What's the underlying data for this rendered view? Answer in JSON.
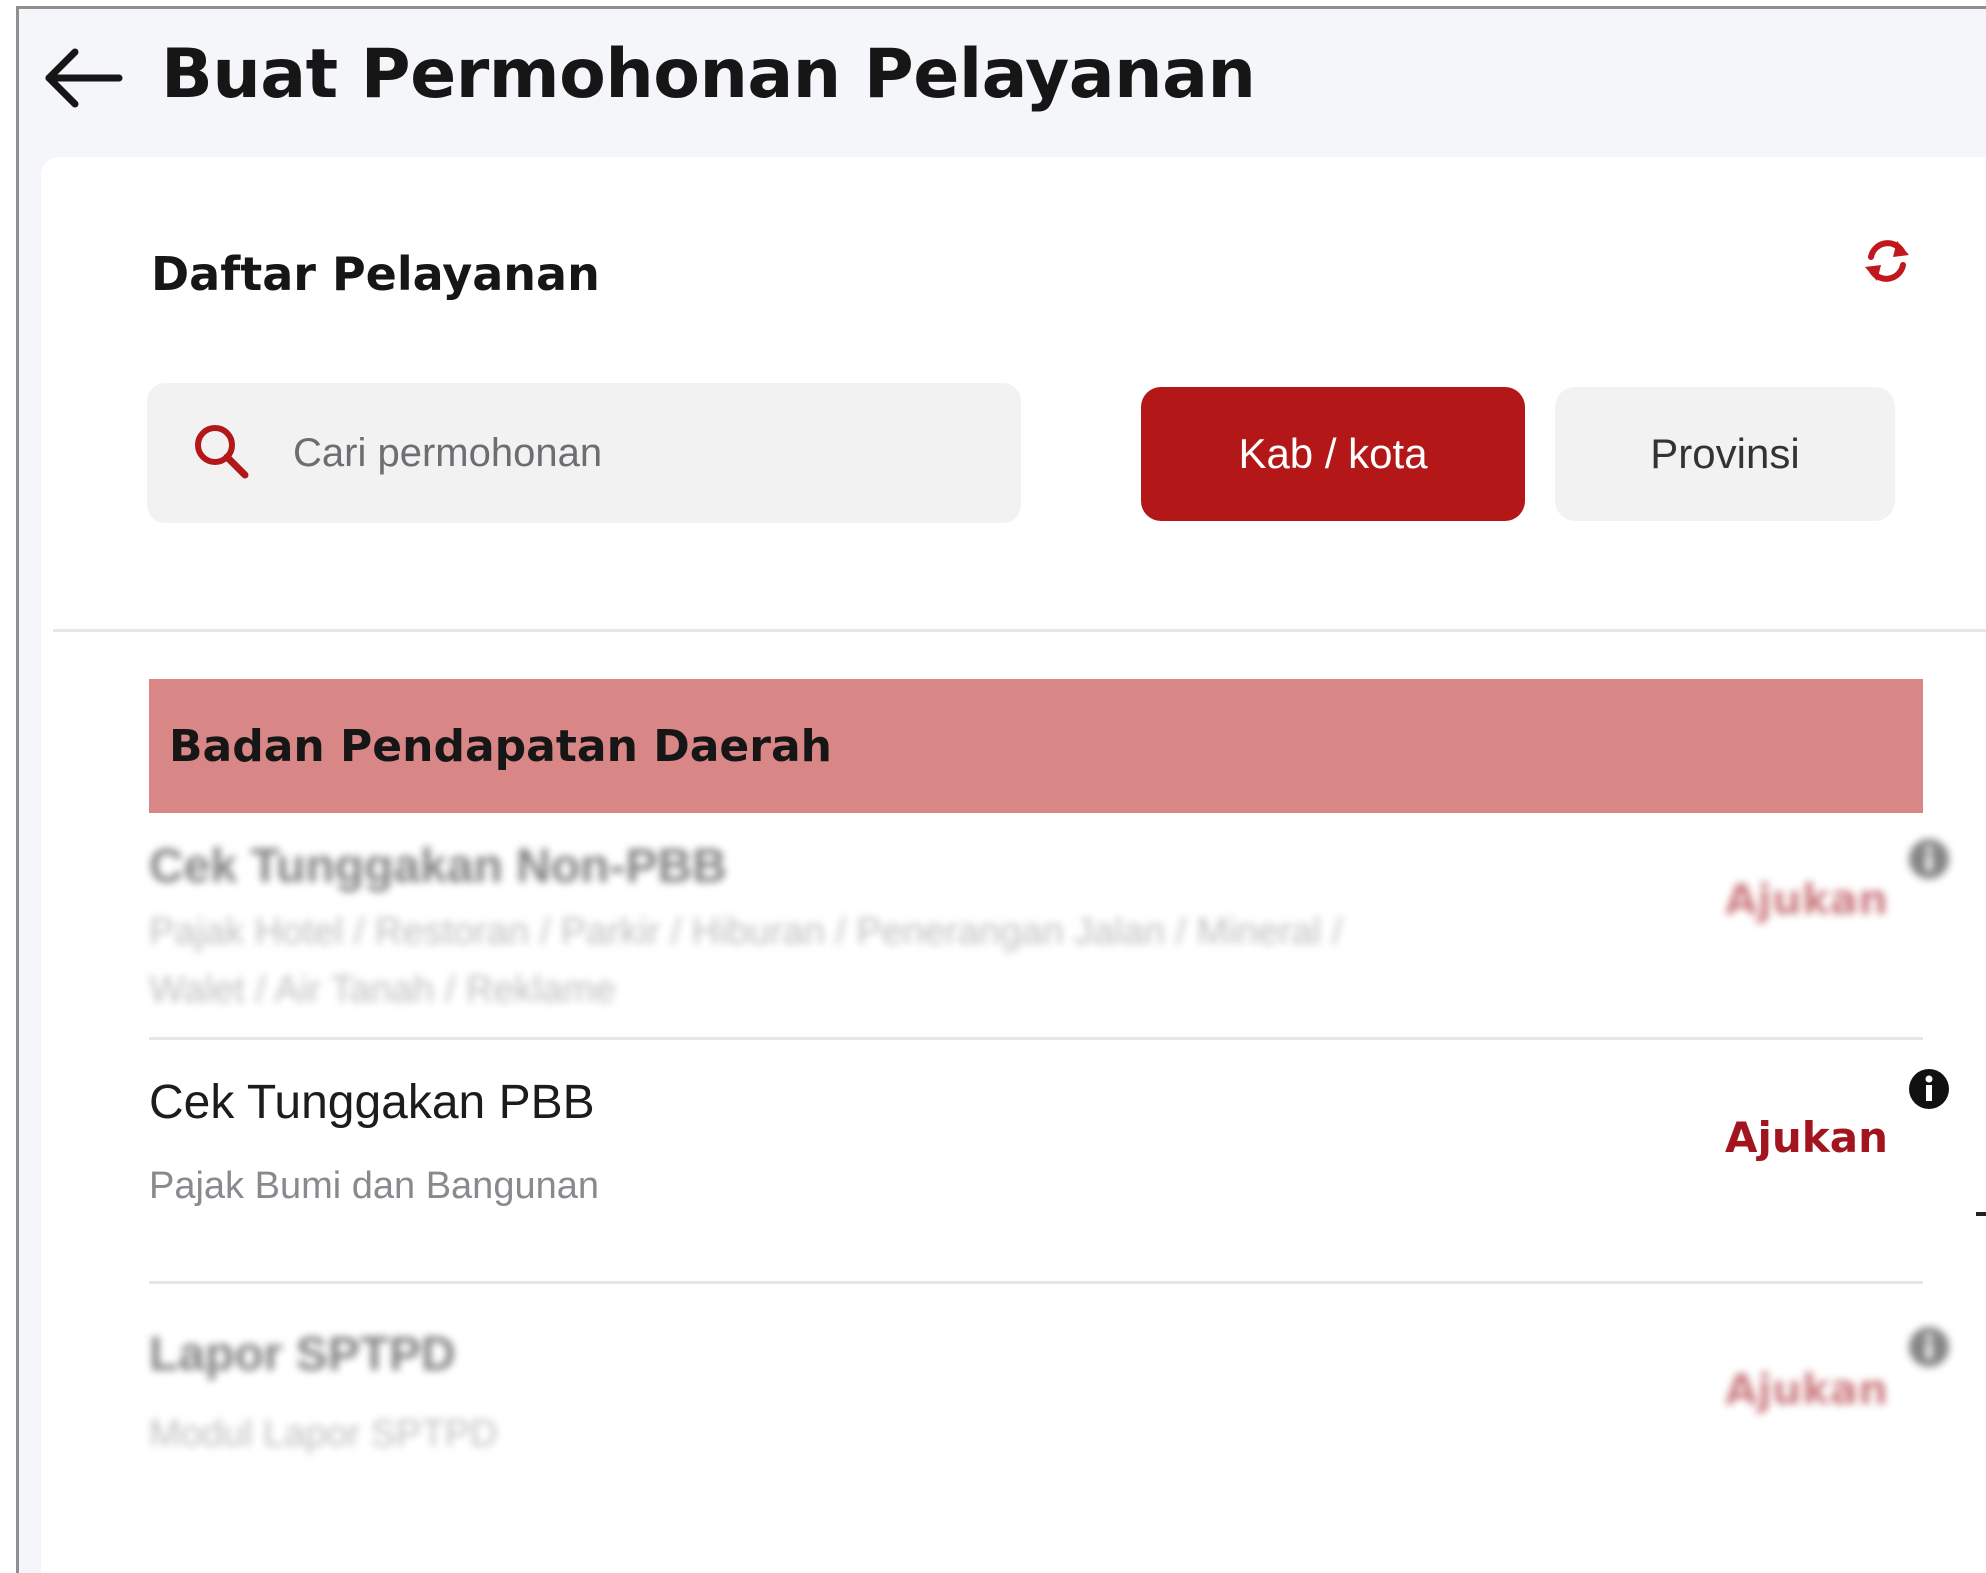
{
  "header": {
    "title": "Buat Permohonan Pelayanan"
  },
  "section": {
    "title": "Daftar Pelayanan"
  },
  "search": {
    "placeholder": "Cari permohonan"
  },
  "filters": {
    "kab_kota": "Kab / kota",
    "provinsi": "Provinsi",
    "active": "kab_kota"
  },
  "group": {
    "title": "Badan Pendapatan Daerah"
  },
  "services": [
    {
      "title": "Cek Tunggakan Non-PBB",
      "description": "Pajak Hotel / Restoran / Parkir / Hiburan / Penerangan Jalan / Mineral / Walet / Air Tanah / Reklame",
      "action": "Ajukan",
      "blurred": true
    },
    {
      "title": "Cek Tunggakan PBB",
      "description": "Pajak Bumi dan Bangunan",
      "action": "Ajukan",
      "blurred": false
    },
    {
      "title": "Lapor SPTPD",
      "description": "Modul Lapor SPTPD",
      "action": "Ajukan",
      "blurred": true
    }
  ],
  "icons": {
    "back": "back-arrow-icon",
    "refresh": "refresh-icon",
    "search": "search-icon",
    "info": "info-icon"
  },
  "colors": {
    "accent": "#b31717",
    "group_header": "#d98686",
    "action_text": "#a3151e"
  }
}
